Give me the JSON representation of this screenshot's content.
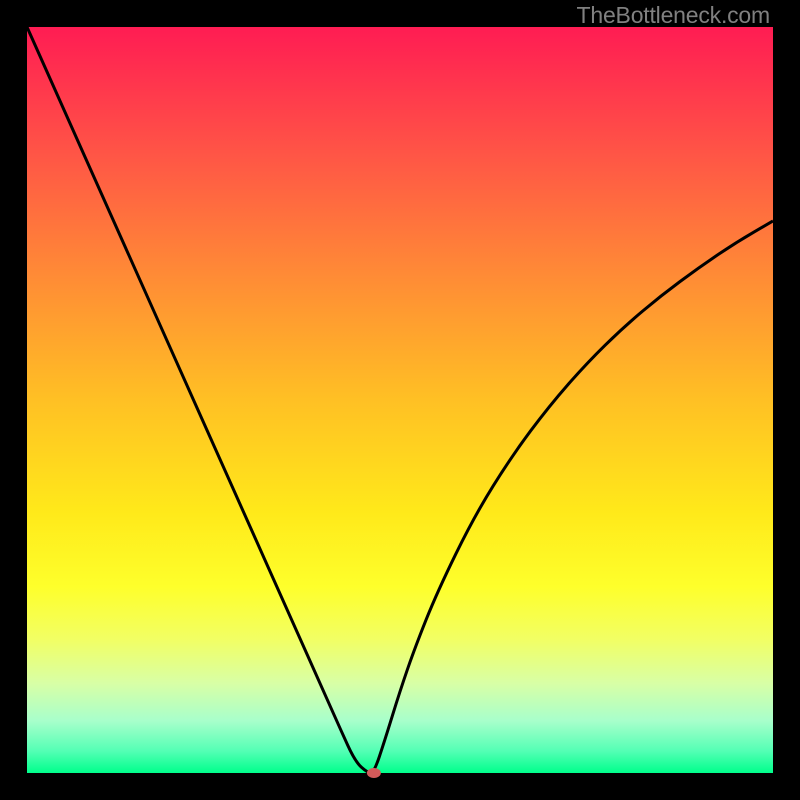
{
  "watermark": "TheBottleneck.com",
  "chart_data": {
    "type": "line",
    "title": "",
    "xlabel": "",
    "ylabel": "",
    "xlim": [
      0,
      1
    ],
    "ylim": [
      0,
      1
    ],
    "series": [
      {
        "name": "curve",
        "x": [
          0.0,
          0.05,
          0.1,
          0.15,
          0.2,
          0.25,
          0.3,
          0.35,
          0.4,
          0.42,
          0.44,
          0.457,
          0.465,
          0.48,
          0.5,
          0.52,
          0.55,
          0.6,
          0.65,
          0.7,
          0.75,
          0.8,
          0.85,
          0.9,
          0.95,
          1.0
        ],
        "y": [
          1.0,
          0.888,
          0.776,
          0.664,
          0.552,
          0.44,
          0.328,
          0.216,
          0.104,
          0.059,
          0.015,
          0.0,
          0.0,
          0.045,
          0.11,
          0.168,
          0.243,
          0.345,
          0.425,
          0.492,
          0.549,
          0.598,
          0.64,
          0.677,
          0.711,
          0.74
        ]
      }
    ],
    "marker": {
      "x": 0.465,
      "y": 0.0
    },
    "colors": {
      "curve": "#000000",
      "marker": "#d25a5a",
      "background_top": "#ff1c53",
      "background_bottom": "#00ff8c"
    }
  }
}
